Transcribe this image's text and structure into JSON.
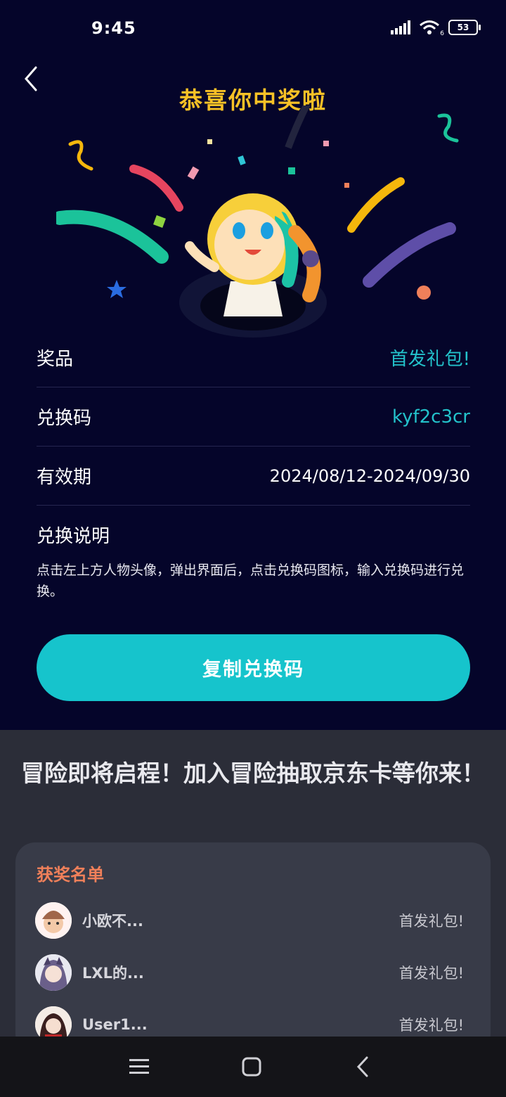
{
  "status": {
    "time": "9:45",
    "battery": "53",
    "wifi_badge": "6"
  },
  "header": {
    "title": "恭喜你中奖啦"
  },
  "info": {
    "rows": [
      {
        "label": "奖品",
        "value": "首发礼包!"
      },
      {
        "label": "兑换码",
        "value": "kyf2c3cr"
      },
      {
        "label": "有效期",
        "value": "2024/08/12-2024/09/30"
      }
    ],
    "desc_title": "兑换说明",
    "desc_text": "点击左上方人物头像，弹出界面后，点击兑换码图标，输入兑换码进行兑换。"
  },
  "copy_button": {
    "label": "复制兑换码"
  },
  "promo": {
    "text": "冒险即将启程！加入冒险抽取京东卡等你来！"
  },
  "winners": {
    "title": "获奖名单",
    "items": [
      {
        "name": "小欧不...",
        "prize": "首发礼包!"
      },
      {
        "name": "LXL的...",
        "prize": "首发礼包!"
      },
      {
        "name": "User1...",
        "prize": "首发礼包!"
      }
    ]
  },
  "colors": {
    "accent": "#16c4cc",
    "title_gold": "#f8c126",
    "winner_title": "#f0805a"
  }
}
